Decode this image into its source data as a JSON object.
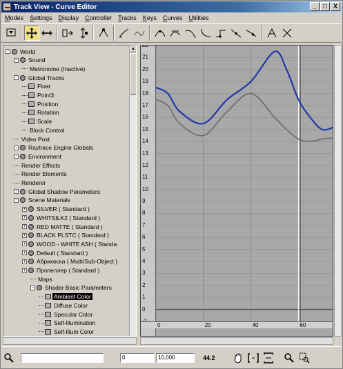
{
  "window": {
    "title": "Track View - Curve Editor",
    "buttons": [
      "_",
      "□",
      "X"
    ]
  },
  "menu": [
    "Modes",
    "Settings",
    "Display",
    "Controller",
    "Tracks",
    "Keys",
    "Curves",
    "Utilities"
  ],
  "toolbar": {
    "tools": [
      "filters-icon",
      "move-keys-icon",
      "slide-keys-icon",
      "scale-keys-icon",
      "scale-values-icon",
      "add-keys-icon",
      "draw-curves-icon",
      "reduce-keys-icon",
      "tangent-auto-icon",
      "tangent-custom-icon",
      "tangent-fast-icon",
      "tangent-slow-icon",
      "tangent-step-icon",
      "tangent-linear-icon",
      "tangent-smooth-icon",
      "lock-selection-icon",
      "snap-frames-icon"
    ]
  },
  "tree": {
    "items": [
      {
        "label": "World",
        "level": 0,
        "kind": "root"
      },
      {
        "label": "Sound",
        "level": 1,
        "kind": "node"
      },
      {
        "label": "Metronome (Inactive)",
        "level": 2,
        "kind": "leaf"
      },
      {
        "label": "Global Tracks",
        "level": 1,
        "kind": "node"
      },
      {
        "label": "Float",
        "level": 2,
        "kind": "sq"
      },
      {
        "label": "Point3",
        "level": 2,
        "kind": "sq"
      },
      {
        "label": "Position",
        "level": 2,
        "kind": "sq"
      },
      {
        "label": "Rotation",
        "level": 2,
        "kind": "sq"
      },
      {
        "label": "Scale",
        "level": 2,
        "kind": "sq"
      },
      {
        "label": "Block Control",
        "level": 2,
        "kind": "leaf"
      },
      {
        "label": "Video Post",
        "level": 1,
        "kind": "leaf"
      },
      {
        "label": "Raytrace Engine Globals",
        "level": 1,
        "kind": "node"
      },
      {
        "label": "Environment",
        "level": 1,
        "kind": "node"
      },
      {
        "label": "Render Effects",
        "level": 1,
        "kind": "leaf"
      },
      {
        "label": "Render Elements",
        "level": 1,
        "kind": "leaf"
      },
      {
        "label": "Renderer",
        "level": 1,
        "kind": "leaf"
      },
      {
        "label": "Global Shadow Parameters",
        "level": 1,
        "kind": "node"
      },
      {
        "label": "Scene Materials",
        "level": 1,
        "kind": "node"
      },
      {
        "label": "SILVER ( Standard )",
        "level": 2,
        "kind": "mat"
      },
      {
        "label": "WHITSILK2 ( Standard )",
        "level": 2,
        "kind": "mat"
      },
      {
        "label": "RED MATTE ( Standard )",
        "level": 2,
        "kind": "mat"
      },
      {
        "label": "BLACK PLSTC ( Standard )",
        "level": 2,
        "kind": "mat"
      },
      {
        "label": "WOOD - WHITE ASH ( Standa",
        "level": 2,
        "kind": "mat"
      },
      {
        "label": "Default ( Standard )",
        "level": 2,
        "kind": "mat"
      },
      {
        "label": "Абрикоска ( Multi/Sub-Object )",
        "level": 2,
        "kind": "mat"
      },
      {
        "label": "Пропеллер ( Standard )",
        "level": 2,
        "kind": "mat"
      },
      {
        "label": "Maps",
        "level": 3,
        "kind": "leaf"
      },
      {
        "label": "Shader Basic Parameters",
        "level": 3,
        "kind": "node"
      },
      {
        "label": "Ambient Color",
        "level": 4,
        "kind": "sq",
        "selected": true
      },
      {
        "label": "Diffuse Color",
        "level": 4,
        "kind": "sq"
      },
      {
        "label": "Specular Color",
        "level": 4,
        "kind": "sq"
      },
      {
        "label": "Self-Illumination",
        "level": 4,
        "kind": "sq"
      },
      {
        "label": "Self-Illum Color",
        "level": 4,
        "kind": "sq"
      }
    ]
  },
  "curve": {
    "y_ticks": [
      "22",
      "21",
      "20",
      "19",
      "18",
      "17",
      "16",
      "15",
      "14",
      "13",
      "12",
      "11",
      "10",
      "9",
      "8",
      "7",
      "6",
      "5",
      "4",
      "3",
      "2",
      "1",
      "0",
      "-1"
    ],
    "x_ticks": [
      "0",
      "20",
      "40",
      "60"
    ],
    "current_frame_marker": "60",
    "colors": {
      "blue_curve": "#2238a8",
      "gray_curve": "#707070",
      "background": "#a8a8a8",
      "frame_line": "#ffffff"
    }
  },
  "status": {
    "frame_field": "0",
    "value_field": "10,000",
    "zoom_value": "44.2"
  },
  "chart_data": {
    "type": "line",
    "xlim": [
      0,
      75
    ],
    "ylim": [
      -1,
      22
    ],
    "series": [
      {
        "color": "#2238a8",
        "x": [
          0,
          5,
          10,
          20,
          30,
          40,
          50,
          55,
          60,
          65,
          70,
          75
        ],
        "y": [
          18.5,
          18,
          16.5,
          15.5,
          17.5,
          19,
          21.5,
          20,
          17.5,
          16,
          15,
          15.2
        ]
      },
      {
        "color": "#707070",
        "x": [
          0,
          5,
          10,
          20,
          30,
          40,
          50,
          55,
          60,
          65,
          70,
          75
        ],
        "y": [
          17.5,
          17,
          15.5,
          14.5,
          16.5,
          18,
          16,
          15,
          14.2,
          14,
          14.2,
          14.3
        ]
      }
    ]
  }
}
